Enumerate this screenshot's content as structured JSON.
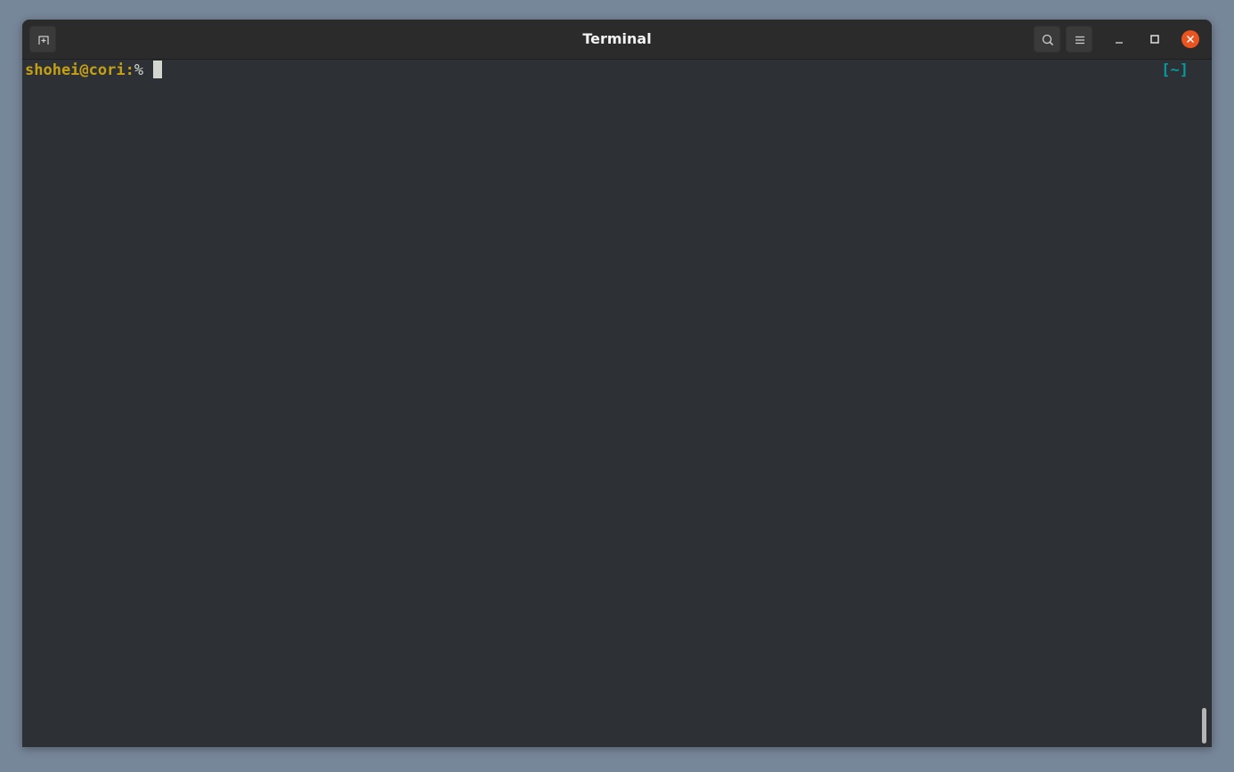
{
  "window": {
    "title": "Terminal"
  },
  "header": {
    "new_tab_icon": "new-tab-icon",
    "search_icon": "search-icon",
    "menu_icon": "hamburger-menu-icon",
    "minimize_icon": "minimize-icon",
    "maximize_icon": "maximize-icon",
    "close_icon": "close-icon"
  },
  "terminal": {
    "prompt_user_host": "shohei@cori:",
    "prompt_symbol": "%",
    "right_prompt": "[~]"
  },
  "colors": {
    "background": "#2d3135",
    "titlebar": "#2b2b2b",
    "prompt_user": "#c5a014",
    "right_prompt": "#06989a",
    "close_button": "#e95420",
    "desktop": "#77879a"
  }
}
